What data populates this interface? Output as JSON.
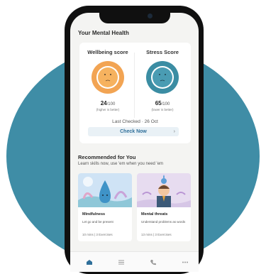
{
  "page": {
    "section_title": "Your Mental Health",
    "wellbeing": {
      "label": "Wellbeing score",
      "value": "24",
      "unit": "/100",
      "note": "(higher is better)",
      "level": 0.24,
      "color": "#f2a453"
    },
    "stress": {
      "label": "Stress Score",
      "value": "65",
      "unit": "/100",
      "note": "(lower is better)",
      "level": 0.65,
      "color": "#3b8da3"
    },
    "last_checked": "Last Checked · 26 Oct",
    "check_now": "Check Now",
    "recommended": {
      "title": "Recommended for You",
      "subtitle": "Learn skills now, use 'em when you need 'em",
      "cards": [
        {
          "name": "Mindfulness",
          "desc": "Let go and be present",
          "meta": "10 mins | 3 Exercises"
        },
        {
          "name": "Mental threats",
          "desc": "Understand problems as words",
          "meta": "13 mins | 3 Exercises"
        }
      ]
    }
  },
  "colors": {
    "teal": "#3f8da6",
    "wellbeing_ring": "#f2a453",
    "stress_ring": "#3b8da3",
    "button_text": "#2f6f9a"
  },
  "icons": [
    "home-icon",
    "menu-icon",
    "phone-icon",
    "more-icon"
  ]
}
